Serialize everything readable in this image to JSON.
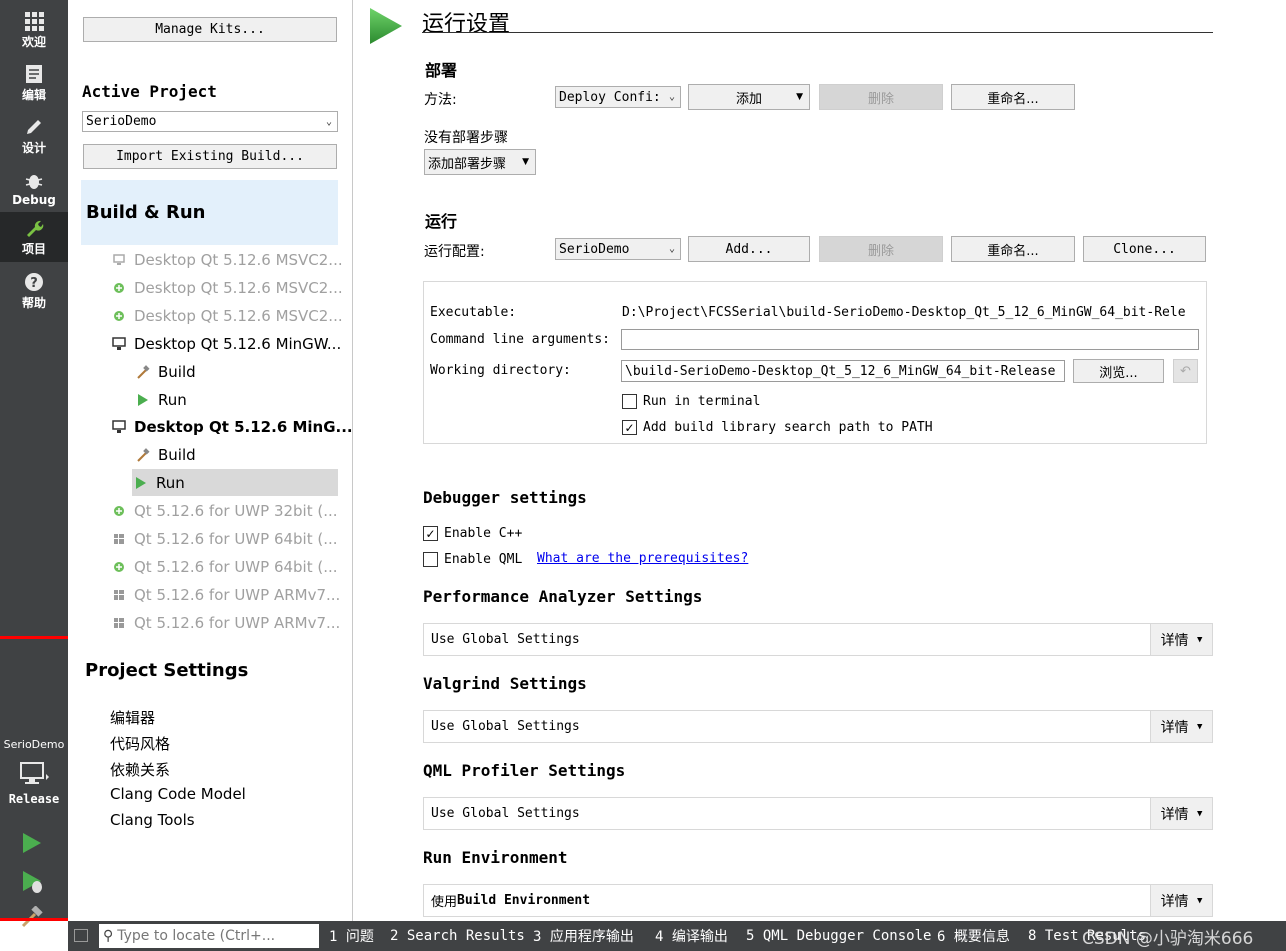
{
  "modebar": {
    "modes": [
      {
        "label": "欢迎",
        "icon": "grid-icon"
      },
      {
        "label": "编辑",
        "icon": "document-icon"
      },
      {
        "label": "设计",
        "icon": "pencil-icon"
      },
      {
        "label": "Debug",
        "icon": "bug-icon"
      },
      {
        "label": "项目",
        "icon": "wrench-icon"
      },
      {
        "label": "帮助",
        "icon": "help-icon"
      }
    ],
    "target_project": "SerioDemo",
    "target_build": "Release"
  },
  "tree": {
    "manage_kits": "Manage Kits...",
    "active_project_heading": "Active Project",
    "active_project": "SerioDemo",
    "import_build": "Import Existing Build...",
    "build_run_heading": "Build & Run",
    "kits": [
      {
        "label": "Desktop Qt 5.12.6 MSVC2...",
        "state": "disabled"
      },
      {
        "label": "Desktop Qt 5.12.6 MSVC2...",
        "state": "disabled"
      },
      {
        "label": "Desktop Qt 5.12.6 MSVC2...",
        "state": "disabled"
      },
      {
        "label": "Desktop Qt 5.12.6 MinGW...",
        "state": "enabled"
      },
      {
        "label": "Build",
        "state": "sub"
      },
      {
        "label": "Run",
        "state": "sub"
      },
      {
        "label": "Desktop Qt 5.12.6 MinG...",
        "state": "active"
      },
      {
        "label": "Build",
        "state": "sub"
      },
      {
        "label": "Run",
        "state": "selected"
      },
      {
        "label": "Qt 5.12.6 for UWP 32bit (...",
        "state": "disabled"
      },
      {
        "label": "Qt 5.12.6 for UWP 64bit (...",
        "state": "disabled"
      },
      {
        "label": "Qt 5.12.6 for UWP 64bit (...",
        "state": "disabled"
      },
      {
        "label": "Qt 5.12.6 for UWP ARMv7...",
        "state": "disabled"
      },
      {
        "label": "Qt 5.12.6 for UWP ARMv7...",
        "state": "disabled"
      }
    ],
    "project_settings_heading": "Project Settings",
    "project_settings": [
      "编辑器",
      "代码风格",
      "依赖关系",
      "Clang Code Model",
      "Clang Tools"
    ]
  },
  "main": {
    "title": "运行设置",
    "deploy": {
      "heading": "部署",
      "method_label": "方法:",
      "method_value": "Deploy Confi:",
      "add": "添加",
      "remove": "删除",
      "rename": "重命名...",
      "no_steps": "没有部署步骤",
      "add_step": "添加部署步骤"
    },
    "run": {
      "heading": "运行",
      "config_label": "运行配置:",
      "config_value": "SerioDemo",
      "add": "Add...",
      "remove": "删除",
      "rename": "重命名...",
      "clone": "Clone...",
      "executable_label": "Executable:",
      "executable_value": "D:\\Project\\FCSSerial\\build-SerioDemo-Desktop_Qt_5_12_6_MinGW_64_bit-Rele",
      "args_label": "Command line arguments:",
      "args_value": "",
      "workdir_label": "Working directory:",
      "workdir_value": "\\build-SerioDemo-Desktop_Qt_5_12_6_MinGW_64_bit-Release",
      "browse": "浏览...",
      "run_in_terminal": "Run in terminal",
      "run_in_terminal_checked": false,
      "add_lib_path": "Add build library search path to PATH",
      "add_lib_path_checked": true
    },
    "debugger": {
      "heading": "Debugger settings",
      "enable_cpp": "Enable C++",
      "enable_cpp_checked": true,
      "enable_qml": "Enable QML",
      "enable_qml_checked": false,
      "prereq_link": "What are the prerequisites?"
    },
    "perf": {
      "heading": "Performance Analyzer Settings",
      "value": "Use Global Settings",
      "details": "详情"
    },
    "valgrind": {
      "heading": "Valgrind Settings",
      "value": "Use Global Settings",
      "details": "详情"
    },
    "qmlprof": {
      "heading": "QML Profiler Settings",
      "value": "Use Global Settings",
      "details": "详情"
    },
    "runenv": {
      "heading": "Run Environment",
      "value_prefix": "使用 ",
      "value_bold": "Build Environment",
      "details": "详情"
    }
  },
  "statusbar": {
    "locate_placeholder": "Type to locate (Ctrl+...",
    "outputs": [
      "1 问题",
      "2 Search Results",
      "3 应用程序输出",
      "4 编译输出",
      "5 QML Debugger Console",
      "6 概要信息",
      "8 Test Results"
    ],
    "watermark": "CSDN @小驴淘米666"
  },
  "colors": {
    "modebar": "#404244",
    "active_mode": "#262829",
    "run_green": "#4bae4f",
    "highlight": "#ff0000",
    "link": "#0000ee"
  }
}
